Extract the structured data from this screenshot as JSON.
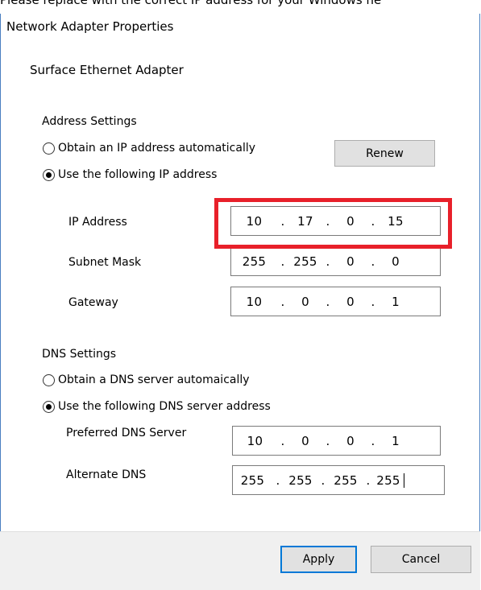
{
  "top_caption": "Please replace with the correct IP address for your Windows ne",
  "dialog": {
    "title": "Network Adapter Properties",
    "adapter_name": "Surface Ethernet Adapter"
  },
  "address_settings": {
    "heading": "Address Settings",
    "option_auto": "Obtain an IP address automatically",
    "option_manual": "Use the following IP address",
    "renew_label": "Renew",
    "ip_label": "IP Address",
    "ip_octets": [
      "10",
      "17",
      "0",
      "15"
    ],
    "subnet_label": "Subnet Mask",
    "subnet_octets": [
      "255",
      "255",
      "0",
      "0"
    ],
    "gateway_label": "Gateway",
    "gateway_octets": [
      "10",
      "0",
      "0",
      "1"
    ],
    "selected": "manual"
  },
  "dns_settings": {
    "heading": "DNS Settings",
    "option_auto": "Obtain a DNS server automaically",
    "option_manual": "Use the following DNS server address",
    "preferred_label": "Preferred DNS Server",
    "preferred_octets": [
      "10",
      "0",
      "0",
      "1"
    ],
    "alternate_label": "Alternate DNS",
    "alternate_octets": [
      "255",
      "255",
      "255",
      "255"
    ],
    "selected": "manual"
  },
  "buttons": {
    "apply": "Apply",
    "cancel": "Cancel"
  },
  "colors": {
    "highlight": "#e8202a",
    "accent": "#0078d7",
    "window_border": "#4a7fc1"
  }
}
